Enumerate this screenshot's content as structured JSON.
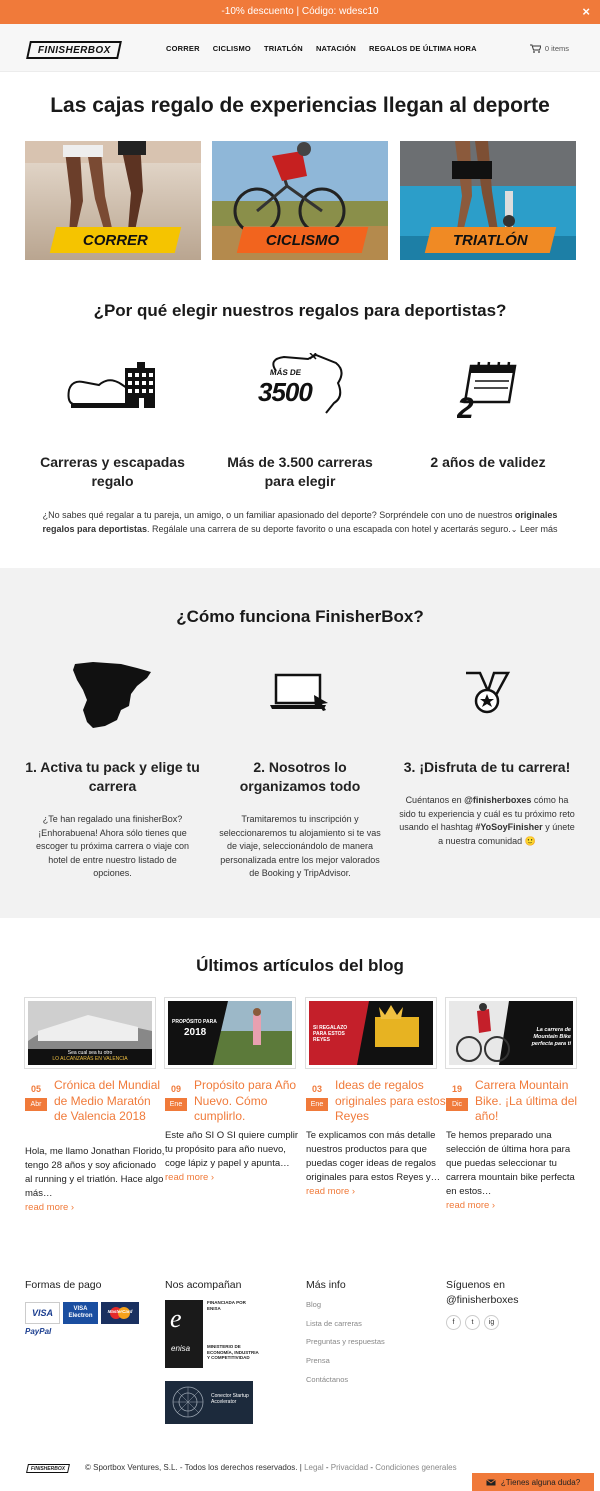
{
  "promo": {
    "text": "-10% descuento | Código: wdesc10",
    "close": "×"
  },
  "header": {
    "logo": "FINISHERBOX",
    "nav": [
      "CORRER",
      "CICLISMO",
      "TRIATLÓN",
      "NATACIÓN",
      "REGALOS DE ÚLTIMA HORA"
    ],
    "cart": "0 items"
  },
  "hero": {
    "title": "Las cajas regalo de experiencias llegan al deporte",
    "cards": [
      {
        "label": "CORRER",
        "color": "#f5c400"
      },
      {
        "label": "CICLISMO",
        "color": "#f2641e"
      },
      {
        "label": "TRIATLÓN",
        "color": "#f08a24"
      }
    ]
  },
  "why": {
    "title": "¿Por qué elegir nuestros regalos para deportistas?",
    "icon_badge": {
      "top": "MÁS DE",
      "number": "3500"
    },
    "features": [
      {
        "title": "Carreras y escapadas regalo"
      },
      {
        "title": "Más de 3.500 carreras para elegir"
      },
      {
        "title": "2 años de validez"
      }
    ],
    "intro_1": "¿No sabes qué regalar a tu pareja, un amigo, o un familiar apasionado del deporte? Sorpréndele con uno de nuestros ",
    "intro_bold": "originales regalos para deportistas",
    "intro_2": ". Regálale una carrera de su deporte favorito o una escapada con hotel y acertarás seguro.",
    "read_more": "Leer más"
  },
  "how": {
    "title": "¿Cómo funciona FinisherBox?",
    "steps": [
      {
        "title": "1. Activa tu pack y elige tu carrera",
        "text": "¿Te han regalado una finisherBox? ¡Enhorabuena! Ahora sólo tienes que escoger tu próxima carrera o viaje con hotel de entre nuestro listado de opciones."
      },
      {
        "title": "2. Nosotros lo organizamos todo",
        "text": "Tramitaremos tu inscripción y seleccionaremos tu alojamiento si te vas de viaje, seleccionándolo de manera personalizada entre los mejor valorados de Booking y TripAdvisor."
      },
      {
        "title": "3. ¡Disfruta de tu carrera!"
      }
    ],
    "step3_text": {
      "a": "Cuéntanos en ",
      "b": "@finisherboxes",
      "c": " cómo ha sido tu experiencia y cuál es tu próximo reto usando el hashtag ",
      "d": "#YoSoyFinisher",
      "e": " y únete a nuestra comunidad 🙂"
    }
  },
  "blog": {
    "title": "Últimos artículos del blog",
    "read_more": "read more ›",
    "posts": [
      {
        "day": "05",
        "month": "Abr",
        "title": "Crónica del Mundial de Medio Maratón de Valencia 2018",
        "excerpt": "Hola, me llamo Jonathan Florido, tengo 28 años y soy aficionado al running y el triatlón. Hace algo más…",
        "thumb_caption_1": "Sea cual sea tu otro",
        "thumb_caption_2": "LO ALCANZARÁS EN VALENCIA"
      },
      {
        "day": "09",
        "month": "Ene",
        "title": "Propósito para Año Nuevo. Cómo cumplirlo.",
        "excerpt": "Este año SI O SI quiere cumplir tu propósito para año nuevo, coge lápiz y papel y apunta…",
        "thumb_caption_1": "PROPÓSITO PARA",
        "thumb_caption_2": "2018"
      },
      {
        "day": "03",
        "month": "Ene",
        "title": "Ideas de regalos originales para estos Reyes",
        "excerpt": "Te explicamos con más detalle nuestros productos para que puedas coger ideas de regalos originales para estos Reyes y…",
        "thumb_caption_1": "SI REGALAZO",
        "thumb_caption_2": "PARA ESTOS REYES"
      },
      {
        "day": "19",
        "month": "Dic",
        "title": "Carrera Mountain Bike. ¡La última del año!",
        "excerpt": "Te hemos preparado una selección de última hora para que puedas seleccionar tu carrera mountain bike perfecta en estos…",
        "thumb_caption_1": "La carrera de",
        "thumb_caption_2": "Mountain Bike perfecta para ti"
      }
    ]
  },
  "footer": {
    "payment_title": "Formas de pago",
    "payments": [
      "VISA",
      "VISA Electron",
      "MasterCard",
      "PayPal"
    ],
    "partners_title": "Nos acompañan",
    "partner_enisa": {
      "name": "enisa",
      "top": "FINANCIADA POR ENISA",
      "bottom": "MINISTERIO DE ECONOMÍA, INDUSTRIA Y COMPETITIVIDAD"
    },
    "partner_startup": "Conector Startup Accelerator",
    "more_title": "Más info",
    "links": [
      "Blog",
      "Lista de carreras",
      "Preguntas y respuestas",
      "Prensa",
      "Contáctanos"
    ],
    "follow_title": "Síguenos en @finisherboxes",
    "social": [
      "f",
      "t",
      "ig"
    ]
  },
  "bottom": {
    "logo": "FINISHERBOX",
    "copyright": "© Sportbox Ventures, S.L. - Todos los derechos reservados. |",
    "legal": "Legal",
    "privacy": "Privacidad",
    "terms": "Condiciones generales",
    "chat": "¿Tienes alguna duda?"
  },
  "colors": {
    "accent": "#f07a3a",
    "band": "#f2f2f2"
  }
}
